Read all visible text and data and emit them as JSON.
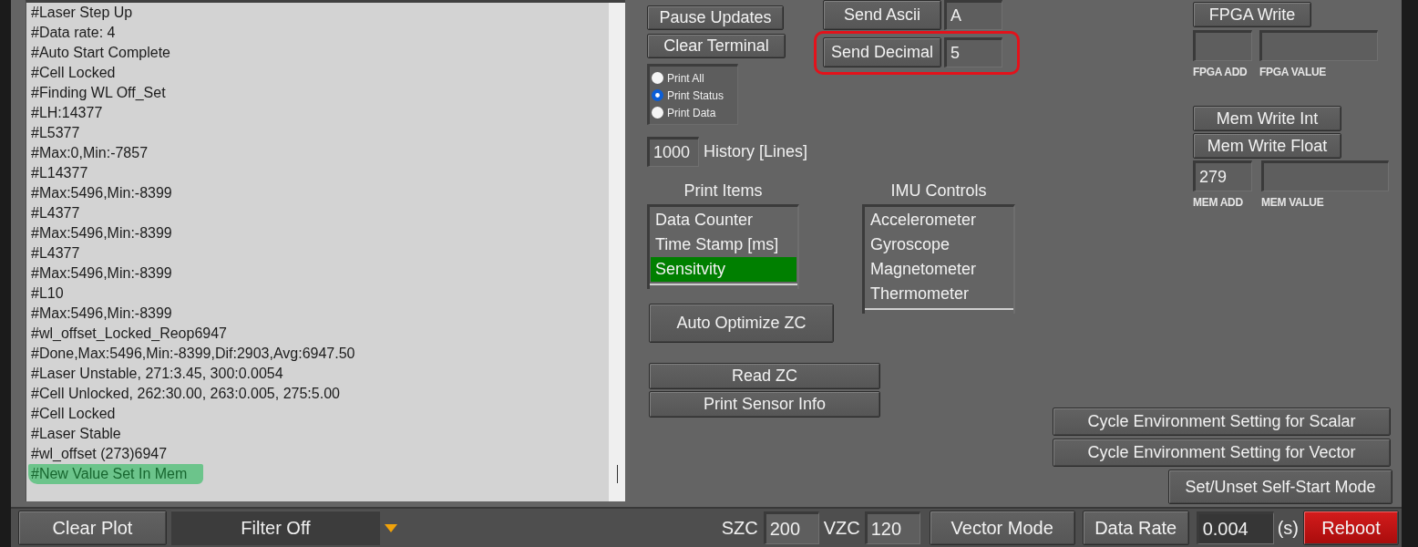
{
  "terminal": {
    "lines": [
      {
        "text": "#Laser Step Up",
        "highlighted": false
      },
      {
        "text": "#Data rate: 4",
        "highlighted": false
      },
      {
        "text": "#Auto Start Complete",
        "highlighted": false
      },
      {
        "text": "#Cell Locked",
        "highlighted": false
      },
      {
        "text": "#Finding WL Off_Set",
        "highlighted": false
      },
      {
        "text": "#LH:14377",
        "highlighted": false
      },
      {
        "text": "#L5377",
        "highlighted": false
      },
      {
        "text": "#Max:0,Min:-7857",
        "highlighted": false
      },
      {
        "text": "#L14377",
        "highlighted": false
      },
      {
        "text": "#Max:5496,Min:-8399",
        "highlighted": false
      },
      {
        "text": "#L4377",
        "highlighted": false
      },
      {
        "text": "#Max:5496,Min:-8399",
        "highlighted": false
      },
      {
        "text": "#L4377",
        "highlighted": false
      },
      {
        "text": "#Max:5496,Min:-8399",
        "highlighted": false
      },
      {
        "text": "#L10",
        "highlighted": false
      },
      {
        "text": "#Max:5496,Min:-8399",
        "highlighted": false
      },
      {
        "text": "#wl_offset_Locked_Reop6947",
        "highlighted": false
      },
      {
        "text": "#Done,Max:5496,Min:-8399,Dif:2903,Avg:6947.50",
        "highlighted": false
      },
      {
        "text": "#Laser Unstable, 271:3.45, 300:0.0054",
        "highlighted": false
      },
      {
        "text": "#Cell Unlocked, 262:30.00, 263:0.005, 275:5.00",
        "highlighted": false
      },
      {
        "text": "#Cell Locked",
        "highlighted": false
      },
      {
        "text": "#Laser Stable",
        "highlighted": false
      },
      {
        "text": "#wl_offset (273)6947",
        "highlighted": false
      },
      {
        "text": "#New Value Set In Mem",
        "highlighted": true
      }
    ]
  },
  "terminal_buttons": [
    "Pause Updates",
    "Clear Terminal"
  ],
  "print_mode": [
    {
      "label": "Print All",
      "selected": false
    },
    {
      "label": "Print Status",
      "selected": true
    },
    {
      "label": "Print Data",
      "selected": false
    }
  ],
  "history": {
    "value": "1000",
    "label": "History [Lines]"
  },
  "send": [
    {
      "button": "Send Ascii",
      "value": "A",
      "outlined": false
    },
    {
      "button": "Send Decimal",
      "value": "5",
      "outlined": true
    }
  ],
  "print_items": {
    "title": "Print Items",
    "items": [
      {
        "label": "Data Counter",
        "selected": false
      },
      {
        "label": "Time Stamp [ms]",
        "selected": false
      },
      {
        "label": "Sensitvity",
        "selected": true
      }
    ]
  },
  "imu_controls": {
    "title": "IMU Controls",
    "items": [
      {
        "label": "Accelerometer",
        "selected": false
      },
      {
        "label": "Gyroscope",
        "selected": false
      },
      {
        "label": "Magnetometer",
        "selected": false
      },
      {
        "label": "Thermometer",
        "selected": false
      }
    ]
  },
  "auto_optimize": "Auto Optimize ZC",
  "zc_buttons": [
    "Read ZC",
    "Print Sensor Info"
  ],
  "fpga": {
    "button": "FPGA Write",
    "fields": [
      {
        "label": "FPGA ADD"
      },
      {
        "label": "FPGA VALUE"
      }
    ]
  },
  "mem": {
    "buttons": [
      "Mem Write Int",
      "Mem Write Float"
    ],
    "fields": [
      {
        "label": "MEM ADD",
        "value": "279"
      },
      {
        "label": "MEM VALUE"
      }
    ]
  },
  "environment_buttons": [
    "Cycle Environment Setting for Scalar",
    "Cycle Environment Setting for Vector"
  ],
  "self_start_button": "Set/Unset Self-Start Mode",
  "bottom_bar": {
    "clear_plot": "Clear Plot",
    "filter": "Filter Off",
    "szc": {
      "label": "SZC",
      "value": "200"
    },
    "vzc": {
      "label": "VZC",
      "value": "120"
    },
    "vector_mode": "Vector Mode",
    "data_rate": {
      "button": "Data Rate",
      "value": "0.004",
      "unit": "(s)"
    },
    "reboot": "Reboot"
  }
}
